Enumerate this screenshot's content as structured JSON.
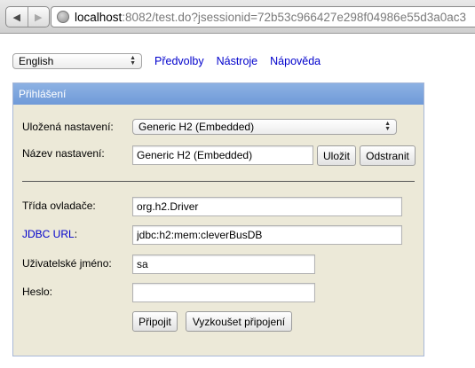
{
  "browser": {
    "url_host": "localhost",
    "url_rest": ":8082/test.do?jsessionid=72b53c966427e298f04986e55d3a0ac3",
    "back_glyph": "◀",
    "forward_glyph": "▶"
  },
  "toolbar": {
    "language": "English",
    "links": [
      "Předvolby",
      "Nástroje",
      "Nápověda"
    ]
  },
  "login": {
    "header": "Přihlášení",
    "saved_settings_label": "Uložená nastavení:",
    "saved_settings_value": "Generic H2 (Embedded)",
    "setting_name_label": "Název nastavení:",
    "setting_name_value": "Generic H2 (Embedded)",
    "save_button": "Uložit",
    "remove_button": "Odstranit",
    "driver_class_label": "Třída ovladače:",
    "driver_class_value": "org.h2.Driver",
    "jdbc_url_label": "JDBC URL",
    "jdbc_url_colon": ":",
    "jdbc_url_value": "jdbc:h2:mem:cleverBusDB",
    "username_label": "Uživatelské jméno:",
    "username_value": "sa",
    "password_label": "Heslo:",
    "password_value": "",
    "connect_button": "Připojit",
    "test_button": "Vyzkoušet připojení"
  },
  "colors": {
    "panel_bg": "#ece9d8",
    "header_bg": "#7aa3dc",
    "link": "#0000cc"
  }
}
